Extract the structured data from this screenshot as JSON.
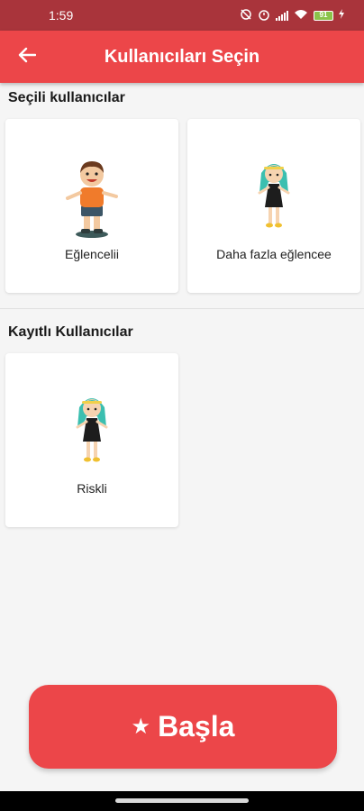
{
  "status_bar": {
    "time": "1:59",
    "battery": "91"
  },
  "app_bar": {
    "title": "Kullanıcıları Seçin",
    "back_icon": "arrow-left-icon"
  },
  "selected_section": {
    "title": "Seçili kullanıcılar",
    "users": [
      {
        "name": "Eğlencelii",
        "avatar": "boy-avatar"
      },
      {
        "name": "Daha fazla eğlencee",
        "avatar": "girl-avatar"
      }
    ]
  },
  "registered_section": {
    "title": "Kayıtlı Kullanıcılar",
    "users": [
      {
        "name": "Riskli",
        "avatar": "girl-avatar"
      }
    ]
  },
  "start_button": {
    "label": "Başla",
    "icon": "star-icon"
  },
  "colors": {
    "primary": "#ec4649",
    "status_bar": "#a9343b",
    "background": "#f5f5f5"
  }
}
